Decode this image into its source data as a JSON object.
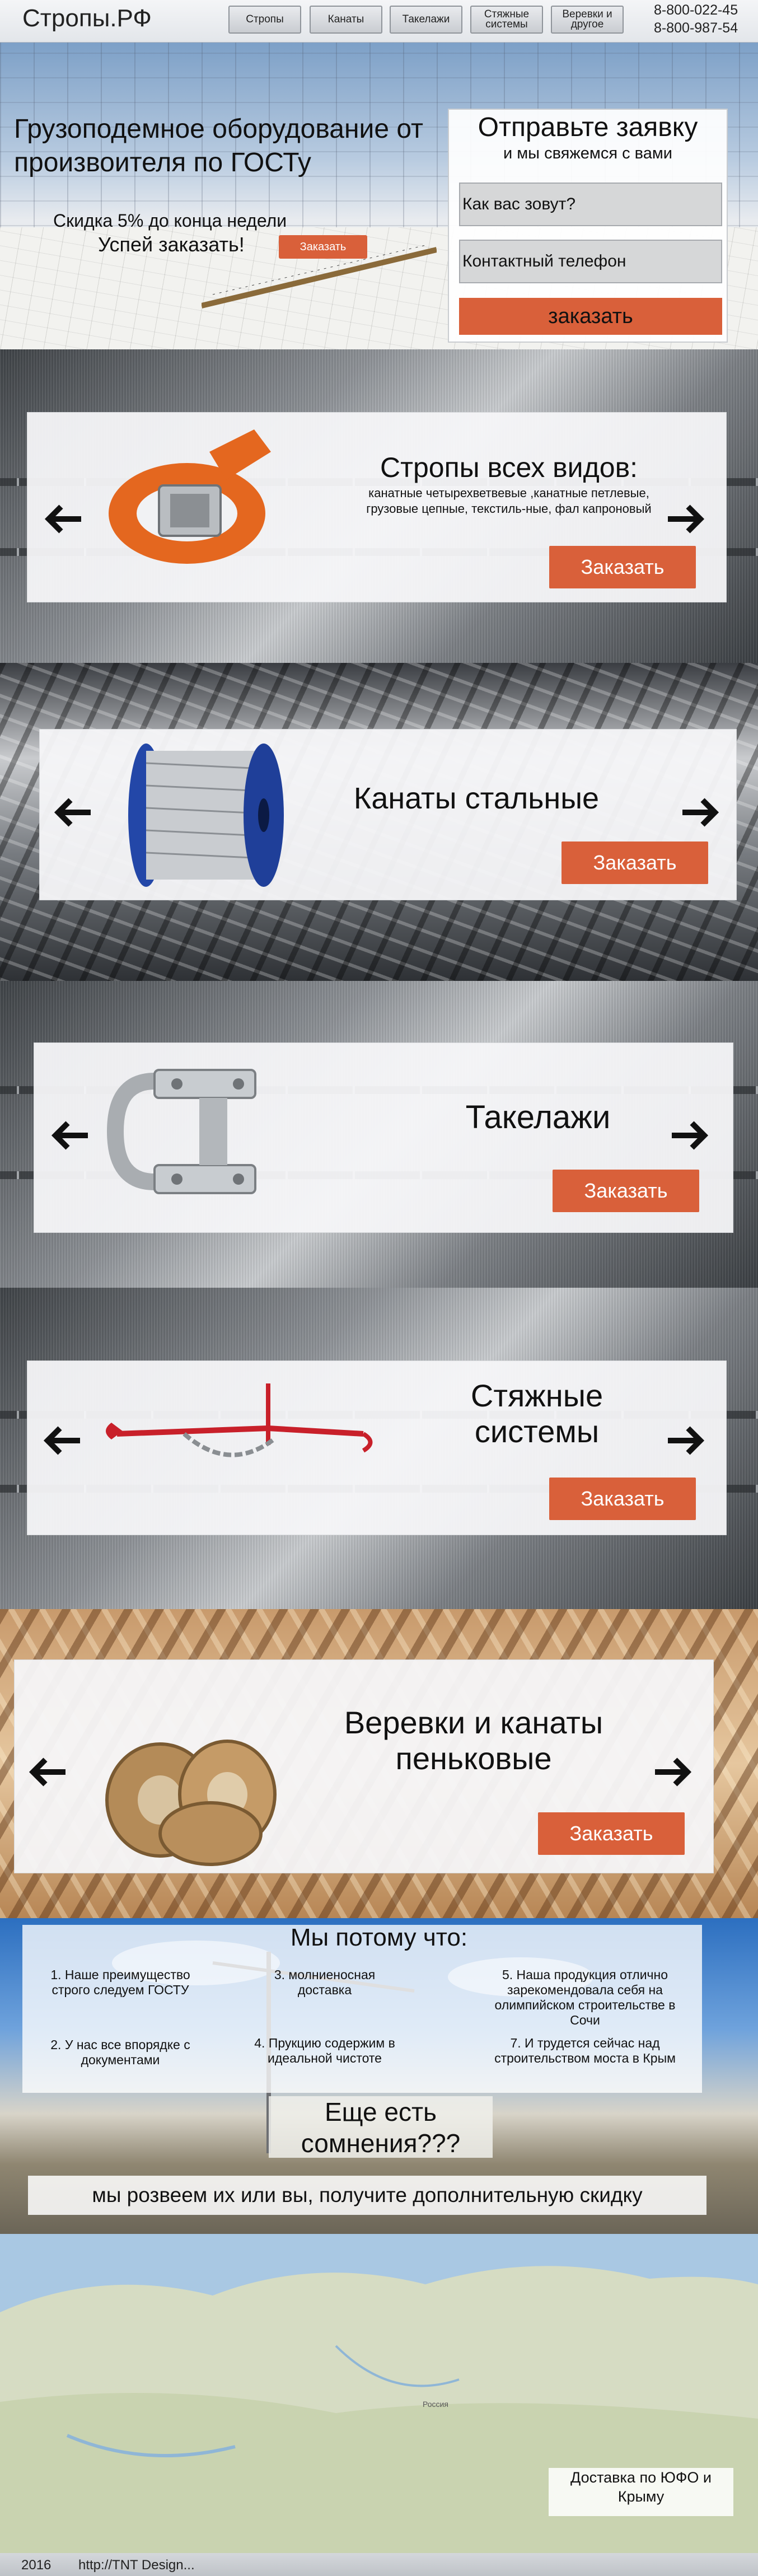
{
  "header": {
    "logo": "Стропы.РФ",
    "nav": [
      {
        "label": "Стропы"
      },
      {
        "label": "Канаты"
      },
      {
        "label": "Такелажи"
      },
      {
        "label": "Стяжные системы"
      },
      {
        "label": "Веревки и другое"
      }
    ],
    "phones": [
      "8-800-022-45",
      "8-800-987-54"
    ]
  },
  "hero": {
    "title": "Грузоподемное оборудование от произвоителя по ГОСТу",
    "discount": "Скидка 5% до конца недели",
    "hurry": "Успей заказать!",
    "order_small": "Заказать"
  },
  "form": {
    "title": "Отправьте заявку",
    "subtitle": "и мы свяжемся с вами",
    "name_placeholder": "Как вас зовут?",
    "phone_placeholder": "Контактный телефон",
    "submit": "заказать"
  },
  "products": [
    {
      "title": "Стропы всех видов:",
      "desc": "канатные четырехветвевые ,канатные петлевые,  грузовые цепные, текстиль-ные, фал капроновый",
      "order": "Заказать",
      "image": "orange-strap-image"
    },
    {
      "title": "Канаты стальные",
      "order": "Заказать",
      "image": "steel-cable-spool-image"
    },
    {
      "title": "Такелажи",
      "order": "Заказать",
      "image": "wire-rope-clip-image"
    },
    {
      "title": "Стяжные системы",
      "order": "Заказать",
      "image": "chain-binder-image"
    },
    {
      "title": "Веревки и канаты пеньковые",
      "order": "Заказать",
      "image": "hemp-rope-coils-image"
    }
  ],
  "advantages": {
    "title": "Мы потому что:",
    "items": [
      "1. Наше преимущество строго следуем ГОСТУ",
      "2. У нас все впорядке с документами",
      "3. молниеносная доставка",
      "4. Прукцию содержим в идеальной чистоте",
      "5. Наша продукция отлично зарекомендовала себя на олимпийском строительстве в Сочи",
      "7. И трудется сейчас над строительством моста в Крым"
    ],
    "doubt": "Еще есть сомнения???",
    "promise": "мы розвеем их или вы, получите дополнительную скидку"
  },
  "map": {
    "label": "Россия",
    "delivery": "Доставка по ЮФО и Крыму"
  },
  "footer": {
    "year": "2016",
    "credit": "http://TNT Design..."
  },
  "colors": {
    "accent": "#d9603a",
    "header_bg": "#e9ebee"
  }
}
